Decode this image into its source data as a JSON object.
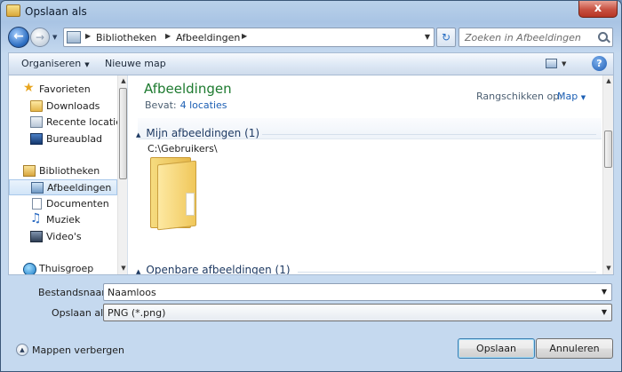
{
  "window": {
    "title": "Opslaan als",
    "close_label": "x"
  },
  "nav": {
    "breadcrumbs": [
      "Bibliotheken",
      "Afbeeldingen"
    ],
    "search_placeholder": "Zoeken in Afbeeldingen"
  },
  "toolbar": {
    "organize_label": "Organiseren",
    "new_folder_label": "Nieuwe map",
    "help_label": "?"
  },
  "sidebar": {
    "items": [
      {
        "label": "Favorieten",
        "icon": "star-icon",
        "group": true
      },
      {
        "label": "Downloads",
        "icon": "folder-icon"
      },
      {
        "label": "Recente locaties",
        "icon": "recent-places-icon"
      },
      {
        "label": "Bureaublad",
        "icon": "desktop-icon"
      },
      {
        "label": "Bibliotheken",
        "icon": "library-icon",
        "group": true
      },
      {
        "label": "Afbeeldingen",
        "icon": "pictures-icon",
        "selected": true
      },
      {
        "label": "Documenten",
        "icon": "documents-icon"
      },
      {
        "label": "Muziek",
        "icon": "music-icon"
      },
      {
        "label": "Video's",
        "icon": "videos-icon"
      },
      {
        "label": "Thuisgroep",
        "icon": "homegroup-icon",
        "group": true
      }
    ]
  },
  "content": {
    "library_title": "Afbeeldingen",
    "includes_label": "Bevat:",
    "includes_link": "4 locaties",
    "arrange_label": "Rangschikken op:",
    "arrange_value": "Map",
    "groups": [
      {
        "title": "Mijn afbeeldingen (1)",
        "path": "C:\\Gebruikers\\"
      },
      {
        "title": "Openbare afbeeldingen (1)"
      }
    ]
  },
  "form": {
    "filename_label": "Bestandsnaam:",
    "filename_value": "Naamloos",
    "type_label": "Opslaan als:",
    "type_value": "PNG (*.png)"
  },
  "footer": {
    "hide_folders_label": "Mappen verbergen",
    "save_label": "Opslaan",
    "cancel_label": "Annuleren"
  },
  "colors": {
    "accent_link": "#1c5fb4",
    "library_title": "#1d7a2f",
    "close_button": "#c75040"
  }
}
